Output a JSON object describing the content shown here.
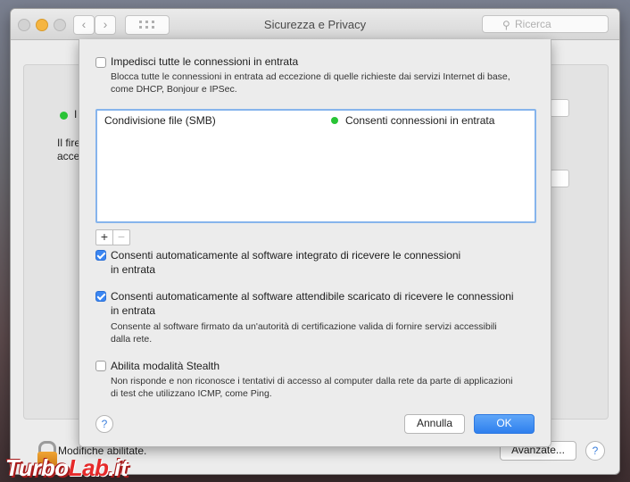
{
  "window": {
    "title": "Sicurezza e Privacy"
  },
  "search": {
    "placeholder": "Ricerca"
  },
  "background": {
    "firewall_text_1": "I",
    "firewall_text_2": "Il fire",
    "firewall_text_3": "acce",
    "status": "Modifiche abilitate.",
    "advanced_button": "Avanzate...",
    "help": "?"
  },
  "sheet": {
    "block_all": {
      "label": "Impedisci tutte le connessioni in entrata",
      "checked": false,
      "description_1": "Blocca tutte le connessioni in entrata ad eccezione di quelle richieste dai servizi Internet di base,",
      "description_2": "come DHCP, Bonjour e IPSec."
    },
    "list": {
      "rows": [
        {
          "name": "Condivisione file (SMB)",
          "state": "Consenti connessioni in entrata",
          "status_color": "#29c436"
        }
      ]
    },
    "add_button": "+",
    "remove_button": "−",
    "auto_builtin": {
      "label_1": "Consenti automaticamente al software integrato di ricevere le connessioni",
      "label_2": "in entrata",
      "checked": true
    },
    "auto_signed": {
      "label_1": "Consenti automaticamente al software attendibile scaricato di ricevere le connessioni",
      "label_2": "in entrata",
      "checked": true,
      "description_1": "Consente al software firmato da un'autorità di certificazione valida di fornire servizi accessibili",
      "description_2": "dalla rete."
    },
    "stealth": {
      "label": "Abilita modalità Stealth",
      "checked": false,
      "description_1": "Non risponde e non riconosce i tentativi di accesso al computer dalla rete da parte di applicazioni",
      "description_2": "di test che utilizzano ICMP, come Ping."
    },
    "help": "?",
    "cancel": "Annulla",
    "ok": "OK"
  },
  "watermark": {
    "part1": "Turbo",
    "part2": "Lab",
    "part3": ".it"
  },
  "colors": {
    "accent": "#3b86f2",
    "status_green": "#29c436"
  }
}
